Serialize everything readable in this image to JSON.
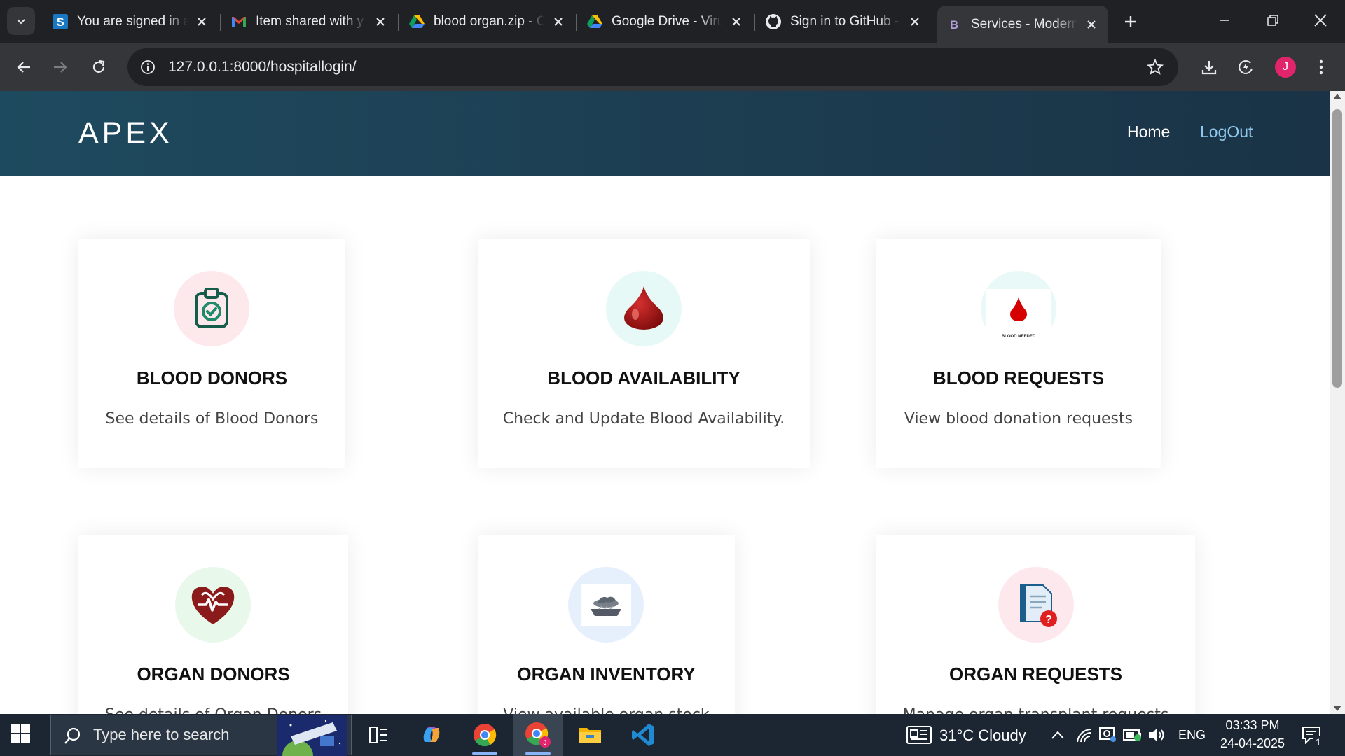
{
  "browser": {
    "tabs": [
      {
        "title": "You are signed in a",
        "favicon": "sharepoint-s-icon",
        "active": false
      },
      {
        "title": "Item shared with y",
        "favicon": "gmail-icon",
        "active": false
      },
      {
        "title": "blood organ.zip - C",
        "favicon": "google-drive-icon",
        "active": false
      },
      {
        "title": "Google Drive - Viru",
        "favicon": "google-drive-icon",
        "active": false
      },
      {
        "title": "Sign in to GitHub -",
        "favicon": "github-icon",
        "active": false
      },
      {
        "title": "Services - Modern",
        "favicon": "bootstrap-b-icon",
        "active": true
      }
    ],
    "url": "127.0.0.1:8000/hospitallogin/",
    "profile_initial": "J"
  },
  "site": {
    "brand": "APEX",
    "nav": {
      "home": "Home",
      "logout": "LogOut"
    },
    "services": [
      {
        "title": "BLOOD DONORS",
        "description": "See details of Blood Donors",
        "icon": "clipboard-check-icon",
        "circle_color": "#fde8ec"
      },
      {
        "title": "BLOOD AVAILABILITY",
        "description": "Check and Update Blood Availability.",
        "icon": "blood-drop-icon",
        "circle_color": "#e6f9f7"
      },
      {
        "title": "BLOOD REQUESTS",
        "description": "View blood donation requests",
        "icon": "blood-needed-icon",
        "icon_caption": "BLOOD NEEDED",
        "circle_color": "#e9f9f8"
      },
      {
        "title": "ORGAN DONORS",
        "description": "See details of Organ Donors",
        "icon": "heart-pulse-icon",
        "circle_color": "#e8f8ea"
      },
      {
        "title": "ORGAN INVENTORY",
        "description": "View available organ stock",
        "icon": "organ-tray-icon",
        "circle_color": "#e6f0fd"
      },
      {
        "title": "ORGAN REQUESTS",
        "description": "Manage organ transplant requests",
        "icon": "document-question-icon",
        "circle_color": "#fde8ee"
      }
    ]
  },
  "taskbar": {
    "search_placeholder": "Type here to search",
    "weather": "31°C  Cloudy",
    "language": "ENG",
    "time": "03:33 PM",
    "date": "24-04-2025",
    "notification_count": "1",
    "apps": [
      "task-view-icon",
      "copilot-icon",
      "chrome-icon",
      "chrome-profile-icon",
      "file-explorer-icon",
      "vscode-icon"
    ]
  }
}
